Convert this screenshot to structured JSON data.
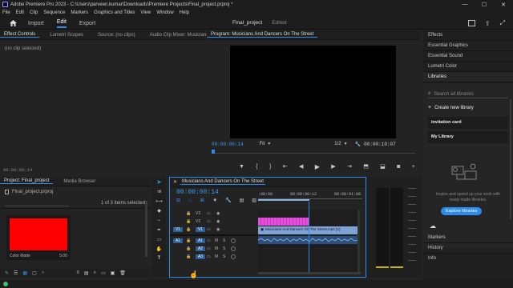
{
  "titlebar": {
    "title": "Adobe Premiere Pro 2023 - C:\\Users\\parveen.kumar\\Downloads\\Premiere Projects\\Final_project.prproj *",
    "controls": [
      "—",
      "☐",
      "✕"
    ]
  },
  "menu": [
    "File",
    "Edit",
    "Clip",
    "Sequence",
    "Markers",
    "Graphics and Titles",
    "View",
    "Window",
    "Help"
  ],
  "header": {
    "workspaces": [
      "Import",
      "Edit",
      "Export"
    ],
    "active": "Edit",
    "project": "Final_project",
    "status": "Edited"
  },
  "effect_controls": {
    "tabs": [
      "Effect Controls",
      "Lumetri Scopes",
      "Source: (no clips)",
      "Audio Clip Mixer: Musicians"
    ],
    "empty": "(no clip selected)",
    "timecode": "00:00:00:14"
  },
  "program": {
    "title": "Program: Musicians And Dancers On The Street",
    "timecode": "00:00:00:14",
    "zoom": "Fit",
    "resolution": "1/2",
    "duration": "00:00:10:07"
  },
  "project": {
    "tabs": [
      "Project: Final_project",
      "Media Browser"
    ],
    "file": "Final_project.prproj",
    "count": "1 of 3 items selected",
    "clip_name": "Color Matte",
    "clip_duration": "5:00"
  },
  "timeline": {
    "title": "Musicians And Dancers On The Street",
    "timecode": "00:00:00:14",
    "ruler": [
      ":00:00",
      "00:00:00:12",
      "00:00:01:00"
    ],
    "clip_label": "Musicians And Dancers On The Street.mp4 [V]",
    "video_tracks": [
      "V3",
      "V2",
      "V1"
    ],
    "audio_tracks": [
      "A1",
      "A2",
      "A3"
    ],
    "source_v": "V1",
    "source_a": "A1",
    "mute": "M",
    "solo": "S"
  },
  "right": {
    "items": [
      "Effects",
      "Essential Graphics",
      "Essential Sound",
      "Lumetri Color",
      "Libraries"
    ],
    "search_placeholder": "Search all libraries",
    "create": "Create new library",
    "lib1": "invitation card",
    "lib2": "My Library",
    "promo": "Inspire and speed up your work with ready made libraries.",
    "promo_button": "Explore libraries",
    "bottom": [
      "Markers",
      "History",
      "Info"
    ]
  },
  "colors": {
    "accent": "#2d8ceb",
    "clip_pink": "#e14fdc",
    "clip_blue": "#7fa3d6",
    "matte_red": "#ff0000"
  }
}
